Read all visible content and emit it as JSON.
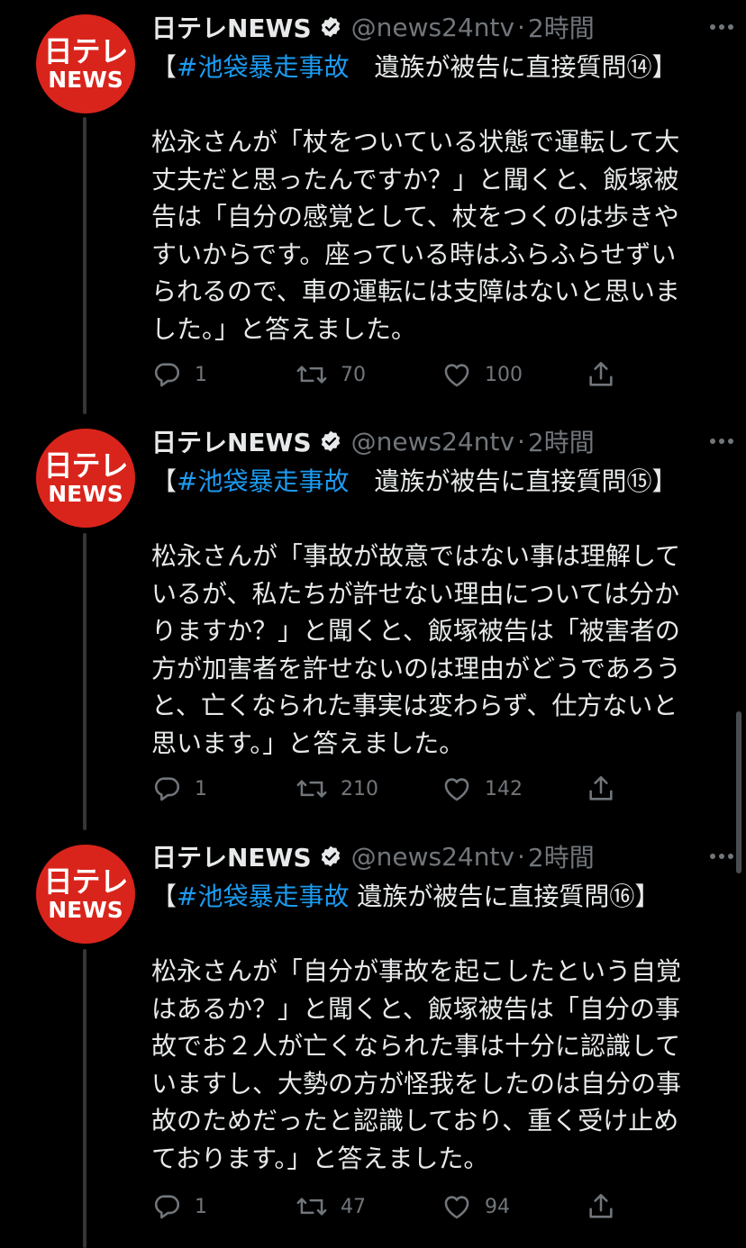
{
  "tweets": [
    {
      "author": "日テレNEWS",
      "handle": "@news24ntv",
      "separator": "·",
      "time": "2時間",
      "avatar_top": "日テレ",
      "avatar_bottom": "NEWS",
      "title_open": "【",
      "hashtag": "#池袋暴走事故",
      "title_rest": "　遺族が被告に直接質問⑭】",
      "body": "松永さんが「杖をついている状態で運転して大丈夫だと思ったんですか？」と聞くと、飯塚被告は「自分の感覚として、杖をつくのは歩きやすいからです。座っている時はふらふらせずいられるので、車の運転には支障はないと思いました。」と答えました。",
      "replies": "1",
      "retweets": "70",
      "likes": "100"
    },
    {
      "author": "日テレNEWS",
      "handle": "@news24ntv",
      "separator": "·",
      "time": "2時間",
      "avatar_top": "日テレ",
      "avatar_bottom": "NEWS",
      "title_open": "【",
      "hashtag": "#池袋暴走事故",
      "title_rest": "　遺族が被告に直接質問⑮】",
      "body": "松永さんが「事故が故意ではない事は理解しているが、私たちが許せない理由については分かりますか？」と聞くと、飯塚被告は「被害者の方が加害者を許せないのは理由がどうであろうと、亡くなられた事実は変わらず、仕方ないと思います。」と答えました。",
      "replies": "1",
      "retweets": "210",
      "likes": "142"
    },
    {
      "author": "日テレNEWS",
      "handle": "@news24ntv",
      "separator": "·",
      "time": "2時間",
      "avatar_top": "日テレ",
      "avatar_bottom": "NEWS",
      "title_open": "【",
      "hashtag": "#池袋暴走事故",
      "title_rest": " 遺族が被告に直接質問⑯】",
      "body": "松永さんが「自分が事故を起こしたという自覚はあるか？」と聞くと、飯塚被告は「自分の事故でお２人が亡くなられた事は十分に認識していますし、大勢の方が怪我をしたのは自分の事故のためだったと認識しており、重く受け止めております。」と答えました。",
      "replies": "1",
      "retweets": "47",
      "likes": "94"
    }
  ],
  "colors": {
    "background": "#000000",
    "text": "#e7e9ea",
    "secondary": "#71767b",
    "hashtag": "#1d9bf0",
    "avatar": "#d9241c"
  },
  "icons": [
    "verified-badge-icon",
    "more-icon",
    "reply-icon",
    "retweet-icon",
    "like-icon",
    "share-icon"
  ]
}
